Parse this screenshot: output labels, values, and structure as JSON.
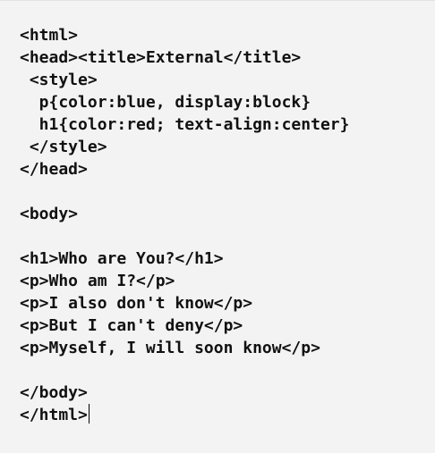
{
  "editor": {
    "lines": [
      "<html>",
      "<head><title>External</title>",
      " <style>",
      "  p{color:blue, display:block}",
      "  h1{color:red; text-align:center}",
      " </style>",
      "</head>",
      "",
      "<body>",
      "",
      "<h1>Who are You?</h1>",
      "<p>Who am I?</p>",
      "<p>I also don't know</p>",
      "<p>But I can't deny</p>",
      "<p>Myself, I will soon know</p>",
      "",
      "</body>",
      "</html>"
    ]
  }
}
